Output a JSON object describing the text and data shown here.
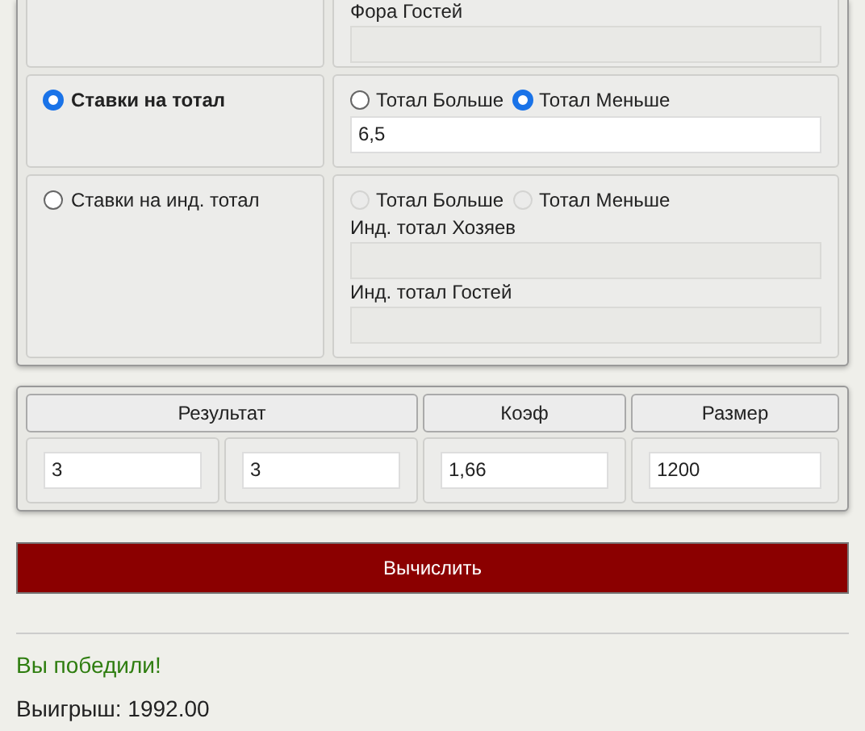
{
  "bet_rows": [
    {
      "kind": "handicap",
      "fields": [
        {
          "label": "Фора Гостей",
          "disabled": true
        }
      ]
    },
    {
      "kind": "total",
      "label": "Ставки на тотал",
      "selected": true,
      "options": [
        {
          "label": "Тотал Больше",
          "selected": false,
          "disabled": false
        },
        {
          "label": "Тотал Меньше",
          "selected": true,
          "disabled": false
        }
      ],
      "fields": [
        {
          "value": "6,5",
          "disabled": false
        }
      ]
    },
    {
      "kind": "individual_total",
      "label": "Ставки на инд. тотал",
      "selected": false,
      "options": [
        {
          "label": "Тотал Больше",
          "selected": false,
          "disabled": true
        },
        {
          "label": "Тотал Меньше",
          "selected": false,
          "disabled": true
        }
      ],
      "fields": [
        {
          "label": "Инд. тотал Хозяев",
          "disabled": true
        },
        {
          "label": "Инд. тотал Гостей",
          "disabled": true
        }
      ]
    }
  ],
  "result_table": {
    "columns": [
      {
        "label": "Результат",
        "inputs": [
          "3",
          "3"
        ]
      },
      {
        "label": "Коэф",
        "inputs": [
          "1,66"
        ]
      },
      {
        "label": "Размер",
        "inputs": [
          "1200"
        ]
      }
    ]
  },
  "calculate_button": "Вычислить",
  "result": {
    "kind": "win",
    "message": "Вы победили!",
    "winnings": "Выигрыш: 1992.00"
  }
}
